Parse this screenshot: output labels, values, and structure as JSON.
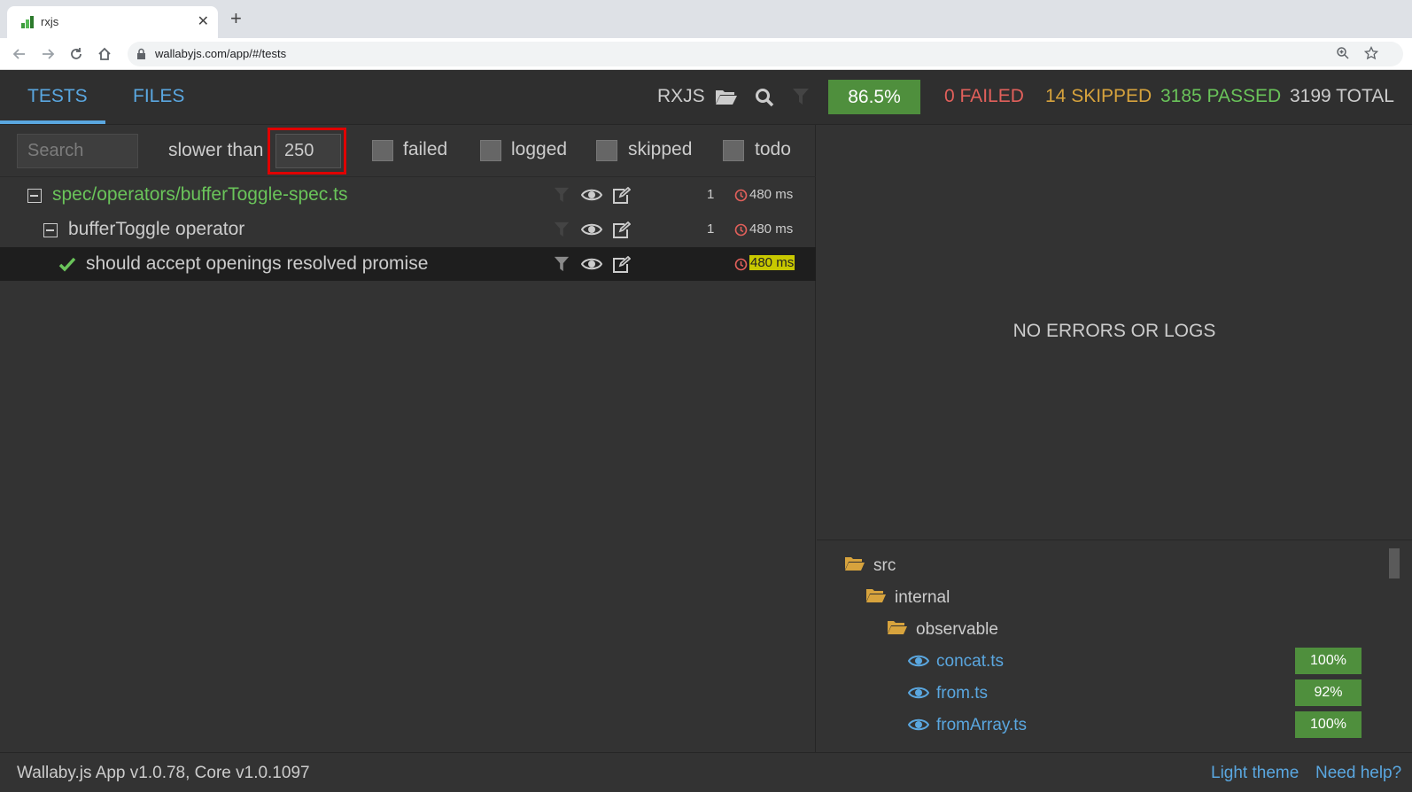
{
  "browser": {
    "tab_title": "rxjs",
    "new_tab": "+",
    "url": "wallabyjs.com/app/#/tests"
  },
  "header": {
    "tabs": [
      {
        "label": "TESTS",
        "active": true
      },
      {
        "label": "FILES",
        "active": false
      }
    ],
    "project": "RXJS",
    "coverage": "86.5%",
    "failed": "0 FAILED",
    "skipped": "14 SKIPPED",
    "passed": "3185 PASSED",
    "total": "3199 TOTAL",
    "colors": {
      "failed": "#e2605b",
      "skipped": "#d7a33d",
      "passed": "#6ac45a",
      "total": "#cccccc",
      "accent": "#5aa7e0",
      "badge": "#4f8f3d"
    }
  },
  "filters": {
    "search_placeholder": "Search",
    "slower_than_label": "slower than",
    "slower_than_value": "250",
    "checkboxes": [
      {
        "label": "failed",
        "checked": false
      },
      {
        "label": "logged",
        "checked": false
      },
      {
        "label": "skipped",
        "checked": false
      },
      {
        "label": "todo",
        "checked": false
      }
    ]
  },
  "tree": [
    {
      "label": "spec/operators/bufferToggle-spec.ts",
      "count": "1",
      "time": "480 ms"
    },
    {
      "label": "bufferToggle operator",
      "count": "1",
      "time": "480 ms"
    },
    {
      "label": "should accept openings resolved promise",
      "count": "",
      "time": "480 ms"
    }
  ],
  "output": {
    "empty_message": "NO ERRORS OR LOGS"
  },
  "files": {
    "folders": [
      "src",
      "internal",
      "observable"
    ],
    "items": [
      {
        "name": "concat.ts",
        "coverage": "100%"
      },
      {
        "name": "from.ts",
        "coverage": "92%"
      },
      {
        "name": "fromArray.ts",
        "coverage": "100%"
      }
    ]
  },
  "footer": {
    "version": "Wallaby.js App v1.0.78, Core v1.0.1097",
    "light_theme": "Light theme",
    "help": "Need help?"
  }
}
